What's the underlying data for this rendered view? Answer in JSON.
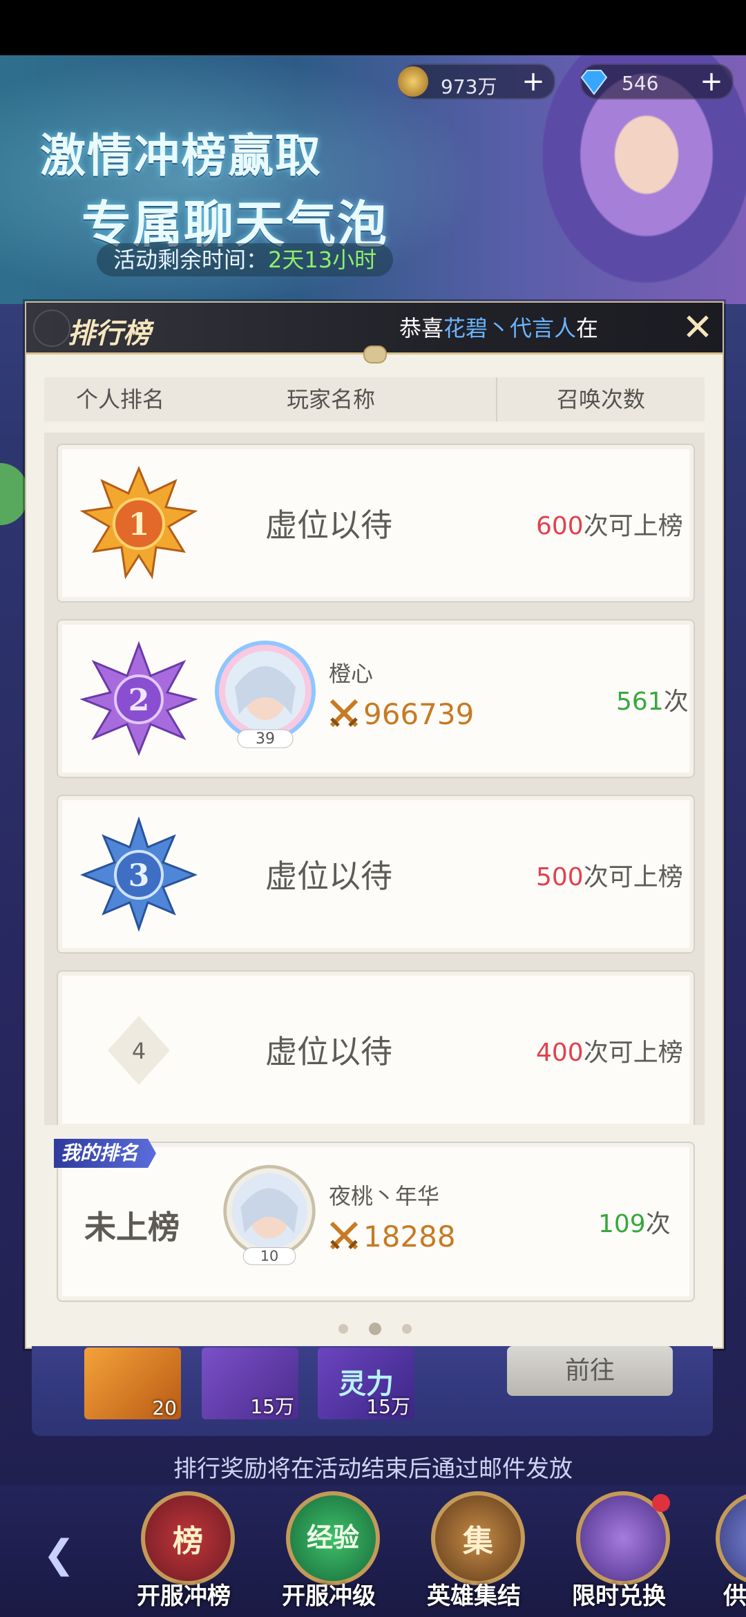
{
  "topbar": {
    "gold_value": "973万",
    "gem_value": "546",
    "gold_icon": "coin-icon",
    "gem_icon": "diamond-icon"
  },
  "banner": {
    "line1": "激情冲榜赢取",
    "line2": "专属聊天气泡",
    "timer_label": "活动剩余时间：",
    "timer_value": "2天13小时"
  },
  "panel": {
    "title": "排行榜",
    "marquee_prefix": "恭喜",
    "marquee_name": "花碧丶代言人",
    "marquee_suffix": "在",
    "columns": [
      "个人排名",
      "玩家名称",
      "召唤次数"
    ],
    "rows": [
      {
        "rank": "1",
        "name": "虚位以待",
        "req_num": "600",
        "req_text": "次可上榜"
      },
      {
        "rank": "2",
        "player": "橙心",
        "level": "39",
        "power": "966739",
        "count_num": "561",
        "count_unit": "次"
      },
      {
        "rank": "3",
        "name": "虚位以待",
        "req_num": "500",
        "req_text": "次可上榜"
      },
      {
        "rank": "4",
        "name": "虚位以待",
        "req_num": "400",
        "req_text": "次可上榜"
      }
    ],
    "my_rank": {
      "tag": "我的排名",
      "status": "未上榜",
      "player": "夜桃丶年华",
      "level": "10",
      "power": "18288",
      "count_num": "109",
      "count_unit": "次"
    }
  },
  "rewards": {
    "items": [
      {
        "count": "20"
      },
      {
        "count": "15万"
      },
      {
        "label": "灵力",
        "count": "15万"
      }
    ],
    "goto_label": "前往",
    "mail_note": "排行奖励将在活动结束后通过邮件发放"
  },
  "tabs": [
    {
      "glyph": "榜",
      "label": "开服冲榜"
    },
    {
      "glyph": "经验",
      "label": "开服冲级"
    },
    {
      "glyph": "集",
      "label": "英雄集结"
    },
    {
      "glyph": "",
      "label": "限时兑换"
    },
    {
      "glyph": "",
      "label": "供"
    }
  ],
  "colors": {
    "accent_red": "#e2404c",
    "accent_green": "#37a83c",
    "power_orange": "#c77a23",
    "marquee_blue": "#6ab5ff",
    "timer_green": "#8df06a"
  }
}
